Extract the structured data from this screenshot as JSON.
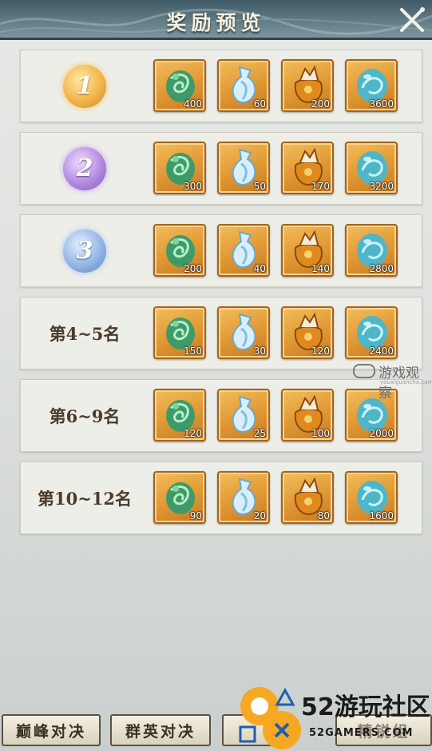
{
  "header": {
    "title": "奖励预览",
    "close_icon": "close-icon"
  },
  "rows": [
    {
      "rank_type": "medal",
      "rank": "1",
      "medal_color": "gold",
      "items": [
        {
          "icon": "jade-dragon-icon",
          "qty": "400"
        },
        {
          "icon": "water-gourd-icon",
          "qty": "60"
        },
        {
          "icon": "treasure-bag-icon",
          "qty": "200"
        },
        {
          "icon": "spirit-orb-icon",
          "qty": "3600"
        }
      ]
    },
    {
      "rank_type": "medal",
      "rank": "2",
      "medal_color": "purple",
      "items": [
        {
          "icon": "jade-dragon-icon",
          "qty": "300"
        },
        {
          "icon": "water-gourd-icon",
          "qty": "50"
        },
        {
          "icon": "treasure-bag-icon",
          "qty": "170"
        },
        {
          "icon": "spirit-orb-icon",
          "qty": "3200"
        }
      ]
    },
    {
      "rank_type": "medal",
      "rank": "3",
      "medal_color": "blue",
      "items": [
        {
          "icon": "jade-dragon-icon",
          "qty": "200"
        },
        {
          "icon": "water-gourd-icon",
          "qty": "40"
        },
        {
          "icon": "treasure-bag-icon",
          "qty": "140"
        },
        {
          "icon": "spirit-orb-icon",
          "qty": "2800"
        }
      ]
    },
    {
      "rank_type": "text",
      "rank": "第4~5名",
      "items": [
        {
          "icon": "jade-dragon-icon",
          "qty": "150"
        },
        {
          "icon": "water-gourd-icon",
          "qty": "30"
        },
        {
          "icon": "treasure-bag-icon",
          "qty": "120"
        },
        {
          "icon": "spirit-orb-icon",
          "qty": "2400"
        }
      ]
    },
    {
      "rank_type": "text",
      "rank": "第6~9名",
      "items": [
        {
          "icon": "jade-dragon-icon",
          "qty": "120"
        },
        {
          "icon": "water-gourd-icon",
          "qty": "25"
        },
        {
          "icon": "treasure-bag-icon",
          "qty": "100"
        },
        {
          "icon": "spirit-orb-icon",
          "qty": "2000"
        }
      ]
    },
    {
      "rank_type": "text",
      "rank": "第10~12名",
      "items": [
        {
          "icon": "jade-dragon-icon",
          "qty": "90"
        },
        {
          "icon": "water-gourd-icon",
          "qty": "20"
        },
        {
          "icon": "treasure-bag-icon",
          "qty": "80"
        },
        {
          "icon": "spirit-orb-icon",
          "qty": "1600"
        }
      ]
    }
  ],
  "tabs": [
    {
      "label": "巅峰对决"
    },
    {
      "label": "群英对决"
    },
    {
      "label": "精锐组"
    }
  ],
  "watermarks": {
    "site1_name": "游戏观察",
    "site1_url": "youxiguancha.com",
    "site2_name": "52游玩社区",
    "site2_url": "52GAMERS.COM"
  },
  "colors": {
    "item_frame": "#e29a35",
    "medal_gold": "#f2b54a",
    "medal_purple": "#b48be0",
    "medal_blue": "#93b6e6",
    "title_bar": "#5a7680"
  }
}
